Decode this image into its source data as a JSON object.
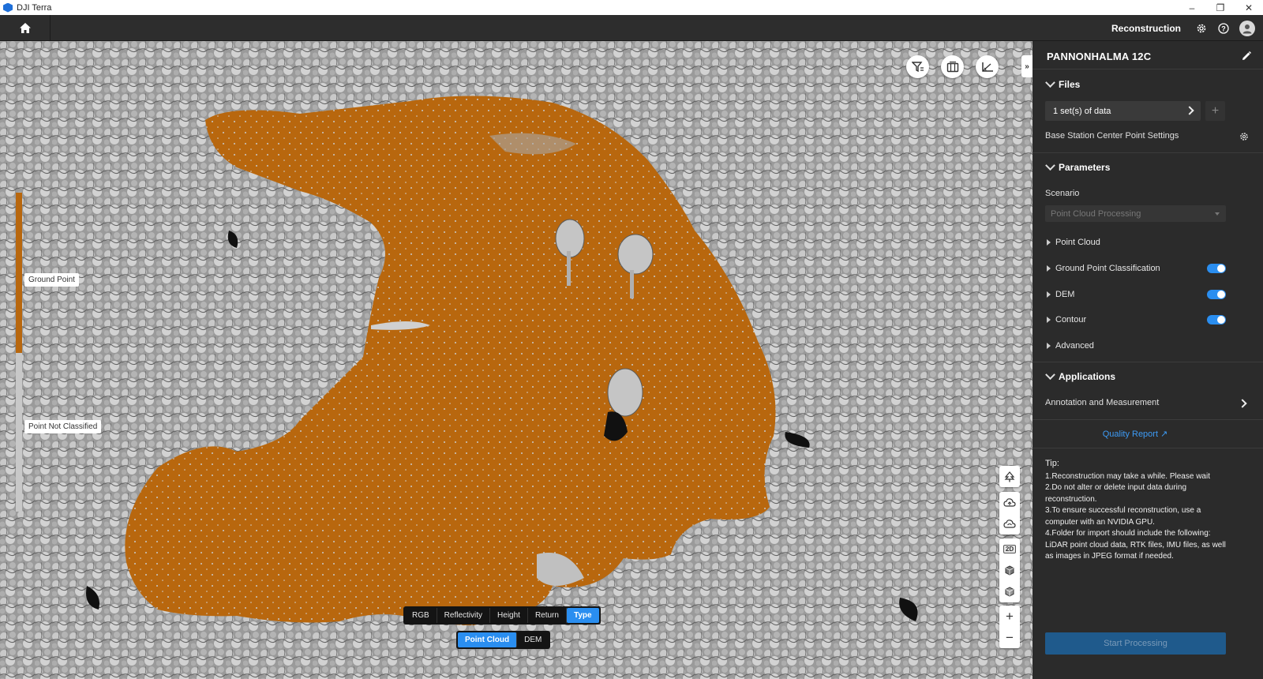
{
  "window": {
    "title": "DJI Terra",
    "minimize": "–",
    "restore": "❐",
    "close": "✕"
  },
  "header": {
    "title": "Reconstruction"
  },
  "legend": {
    "ground_label": "Ground Point",
    "unclassified_label": "Point Not Classified",
    "ground_color": "#b8670e",
    "unclassified_color": "#c8c8c8"
  },
  "color_modes": {
    "options": [
      "RGB",
      "Reflectivity",
      "Height",
      "Return",
      "Type"
    ],
    "selected": "Type"
  },
  "data_modes": {
    "options": [
      "Point Cloud",
      "DEM"
    ],
    "selected": "Point Cloud"
  },
  "view_tools": {
    "badge_2d": "2D",
    "zoom_in": "+",
    "zoom_out": "−"
  },
  "collapse_tab": "»",
  "panel": {
    "project_name": "PANNONHALMA 12C",
    "files": {
      "heading": "Files",
      "data_sets": "1 set(s) of data",
      "add": "+",
      "base_station": "Base Station Center Point Settings"
    },
    "parameters": {
      "heading": "Parameters",
      "scenario_label": "Scenario",
      "scenario_value": "Point Cloud Processing",
      "items": [
        {
          "label": "Point Cloud",
          "toggle": false
        },
        {
          "label": "Ground Point Classification",
          "toggle": true
        },
        {
          "label": "DEM",
          "toggle": true
        },
        {
          "label": "Contour",
          "toggle": true
        },
        {
          "label": "Advanced",
          "toggle": false
        }
      ]
    },
    "applications": {
      "heading": "Applications",
      "annotation": "Annotation and Measurement"
    },
    "quality_report": "Quality Report",
    "tips": {
      "heading": "Tip:",
      "lines": [
        "1.Reconstruction may take a while. Please wait",
        "2.Do not alter or delete input data during reconstruction.",
        "3.To ensure successful reconstruction, use a computer with an NVIDIA GPU.",
        "4.Folder for import should include the following: LiDAR point cloud data, RTK files, IMU files, as well as images in JPEG format if needed."
      ]
    },
    "start_button": "Start Processing"
  },
  "accent_color": "#2a8ef0"
}
